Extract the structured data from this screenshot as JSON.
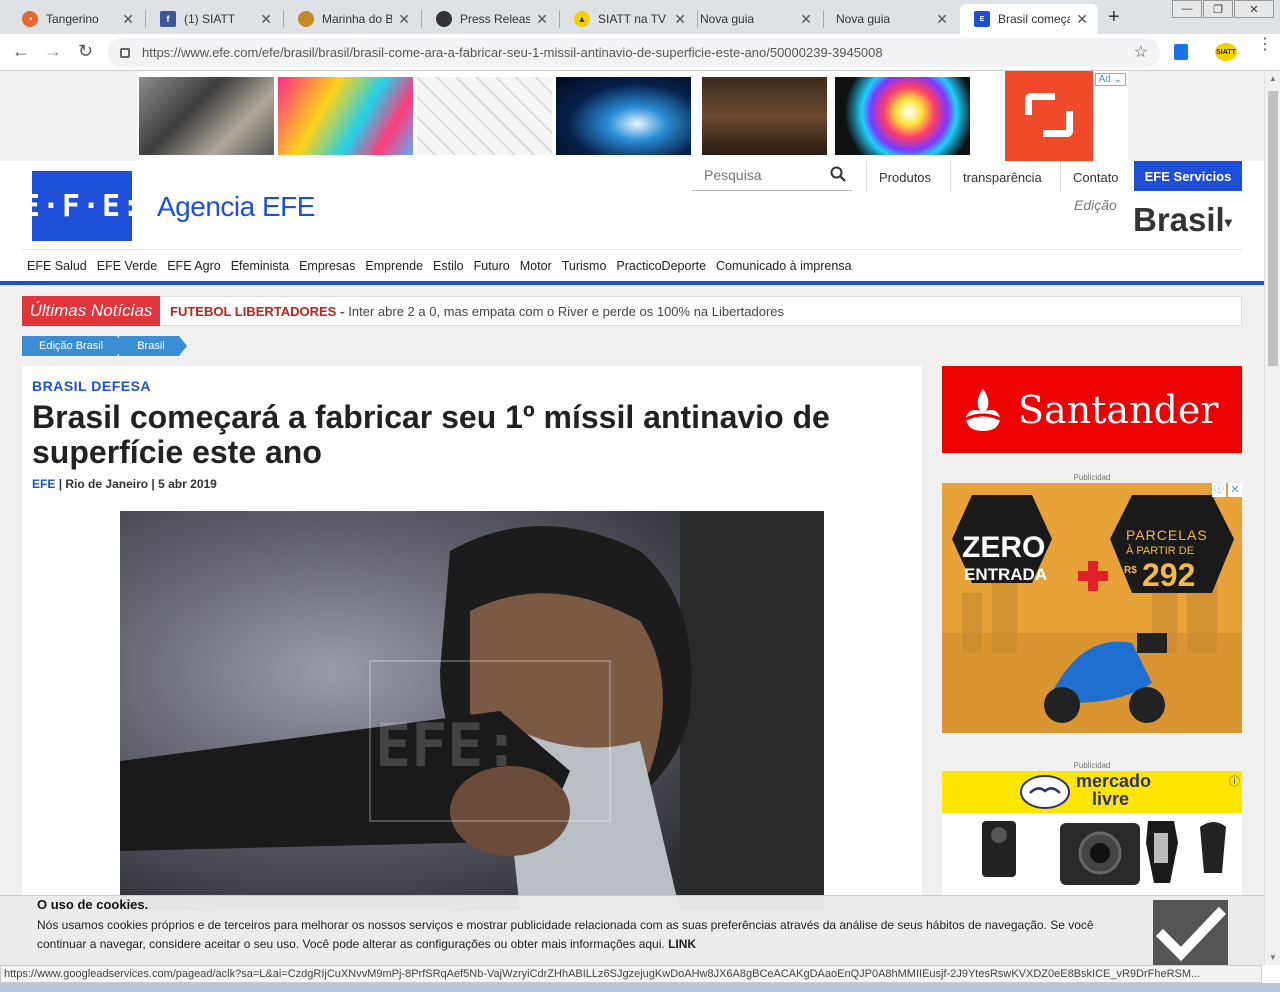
{
  "browser": {
    "tabs": [
      {
        "title": "Tangerino",
        "favicon_color": "#e8672a"
      },
      {
        "title": "(1) SIATT",
        "favicon_color": "#3b5998"
      },
      {
        "title": "Marinha do B",
        "favicon_color": "#c48a22"
      },
      {
        "title": "Press Release",
        "favicon_color": "#333333"
      },
      {
        "title": "SIATT na TV E",
        "favicon_color": "#f4d000"
      },
      {
        "title": "Nova guia",
        "favicon_color": ""
      },
      {
        "title": "Nova guia",
        "favicon_color": ""
      },
      {
        "title": "Brasil começa",
        "favicon_color": "#1f4fd8",
        "active": true
      }
    ],
    "url": "https://www.efe.com/efe/brasil/brasil/brasil-come-ara-a-fabricar-seu-1-missil-antinavio-de-superficie-este-ano/50000239-3945008",
    "status_url": "https://www.googleadservices.com/pagead/aclk?sa=L&ai=CzdgRIjCuXNvvM9mPj-8PrfSRqAef5Nb-VajWzryiCdrZHhABILLz6SJgzejugKwDoAHw8JX6A8gBCeACAKgDAaoEnQJP0A8hMMIIEusjf-2J9YtesRswKVXDZ0eE8BskICE_vR9DrFheRSM..."
  },
  "ad_top": {
    "adchoices_label": "Ad"
  },
  "header": {
    "agency_name": "Agencia EFE",
    "search_placeholder": "Pesquisa",
    "nav": [
      "Produtos",
      "transparência",
      "Contato"
    ],
    "services_button": "EFE Servicios",
    "edition_label": "Edição",
    "edition_value": "Brasil",
    "categories": [
      "EFE Salud",
      "EFE Verde",
      "EFE Agro",
      "Efeminista",
      "Empresas",
      "Emprende",
      "Estilo",
      "Futuro",
      "Motor",
      "Turismo",
      "PracticoDeporte",
      "Comunicado à imprensa"
    ]
  },
  "ticker": {
    "label": "Últimas Notícias",
    "headline": "FUTEBOL LIBERTADORES -",
    "text": "Inter abre 2 a 0, mas empata com o River e perde os 100% na Libertadores"
  },
  "breadcrumbs": [
    "Edição Brasil",
    "Brasil"
  ],
  "article": {
    "kicker": "BRASIL DEFESA",
    "title": "Brasil começará a fabricar seu 1º míssil antinavio de superfície este ano",
    "byline_source": "EFE",
    "byline_sep": "|",
    "byline_place": "Rio de Janeiro",
    "byline_date": "5 abr 2019"
  },
  "sidebar": {
    "santander_name": "Santander",
    "publicidad_label": "Publicidad",
    "moto_ad": {
      "line1": "ZERO",
      "line2": "ENTRADA",
      "line3": "PARCELAS",
      "line4": "À PARTIR DE",
      "currency": "R$",
      "price": "292"
    },
    "ml_ad": {
      "line1": "mercado",
      "line2": "livre"
    }
  },
  "cookie": {
    "heading": "O uso de cookies.",
    "text": "Nós usamos cookies próprios e de terceiros para melhorar os nossos serviços e mostrar publicidade relacionada com as suas preferências através da análise de seus hábitos de navegação. Se você continuar a navegar, considere aceitar o seu uso. Você pode alterar as configurações ou obter mais informações aqui.",
    "link": "LINK"
  },
  "colors": {
    "efe_blue": "#1f4fd8",
    "ticker_red": "#e0353b",
    "santander_red": "#ec0000",
    "crumb_blue": "#3a8fd4"
  },
  "icons": [
    "back-icon",
    "forward-icon",
    "reload-icon",
    "lock-icon",
    "star-icon",
    "search-icon",
    "close-icon",
    "new-tab-icon",
    "menu-icon",
    "checkmark-icon"
  ]
}
